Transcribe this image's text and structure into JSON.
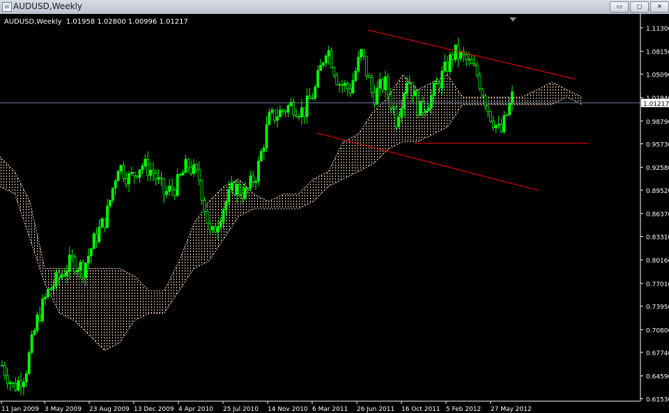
{
  "window": {
    "title": "AUDUSD,Weekly",
    "minimize_label": "▭",
    "restore_label": "◻",
    "close_label": "✕"
  },
  "info": {
    "symbol_timeframe": "AUDUSD,Weekly",
    "ohlc": "1.01958 1.02800 1.00996 1.01217"
  },
  "colors": {
    "background": "#000000",
    "bull_candle": "#00ff00",
    "bear_candle": "#00ff00",
    "cloud": "#ffdab9",
    "trendline": "#ff0000",
    "price_line": "#6e7f99",
    "axis_text": "#ffffff"
  },
  "chart_data": {
    "type": "candlestick",
    "symbol": "AUDUSD",
    "timeframe": "Weekly",
    "last_price": 1.01217,
    "last_price_label": "1.01217",
    "y_range": [
      0.612,
      1.126
    ],
    "y_ticks": [
      "1.11300",
      "1.08150",
      "1.05090",
      "1.01940",
      "0.98790",
      "0.95730",
      "0.92580",
      "0.89520",
      "0.86370",
      "0.83310",
      "0.80160",
      "0.77010",
      "0.73950",
      "0.70800",
      "0.67740",
      "0.64590",
      "0.61530"
    ],
    "x_ticks": [
      "11 Jan 2009",
      "3 May 2009",
      "23 Aug 2009",
      "13 Dec 2009",
      "4 Apr 2010",
      "25 Jul 2010",
      "14 Nov 2010",
      "6 Mar 2011",
      "26 Jun 2011",
      "16 Oct 2011",
      "5 Feb 2012",
      "27 May 2012"
    ],
    "close_path": [
      0.66,
      0.63,
      0.65,
      0.72,
      0.76,
      0.78,
      0.8,
      0.79,
      0.83,
      0.86,
      0.93,
      0.91,
      0.93,
      0.92,
      0.89,
      0.9,
      0.93,
      0.91,
      0.83,
      0.87,
      0.9,
      0.89,
      0.92,
      0.99,
      1.0,
      1.01,
      1.0,
      1.03,
      1.09,
      1.04,
      1.03,
      1.08,
      1.02,
      1.04,
      0.99,
      1.05,
      1.0,
      1.02,
      1.05,
      1.08,
      1.07,
      1.05,
      1.0,
      0.97,
      1.02
    ],
    "ichimoku_cloud": {
      "upper": [
        0.94,
        0.92,
        0.88,
        0.79,
        0.79,
        0.79,
        0.79,
        0.79,
        0.79,
        0.78,
        0.76,
        0.76,
        0.8,
        0.85,
        0.88,
        0.9,
        0.91,
        0.89,
        0.88,
        0.89,
        0.89,
        0.91,
        0.92,
        0.96,
        0.97,
        1.0,
        1.02,
        1.05,
        1.03,
        1.04,
        1.05,
        1.02,
        1.02,
        1.02,
        1.02,
        1.02,
        1.03,
        1.04,
        1.03,
        1.02
      ],
      "lower": [
        0.9,
        0.89,
        0.83,
        0.77,
        0.73,
        0.72,
        0.7,
        0.68,
        0.69,
        0.72,
        0.73,
        0.73,
        0.76,
        0.79,
        0.8,
        0.83,
        0.86,
        0.87,
        0.87,
        0.87,
        0.87,
        0.88,
        0.9,
        0.91,
        0.92,
        0.93,
        0.95,
        0.96,
        0.96,
        0.97,
        0.98,
        1.01,
        1.01,
        1.01,
        1.01,
        1.01,
        1.01,
        1.01,
        1.02,
        1.01
      ]
    },
    "trendlines": [
      {
        "from": [
          "26 Jun 2011",
          1.11
        ],
        "to": [
          "after 27 May 2012",
          1.044
        ]
      },
      {
        "from": [
          "6 Mar 2011",
          0.972
        ],
        "to": [
          "after 27 May 2012",
          0.895
        ]
      },
      {
        "from": [
          "16 Oct 2011",
          0.958
        ],
        "to": [
          "after 27 May 2012",
          0.958
        ]
      }
    ]
  }
}
